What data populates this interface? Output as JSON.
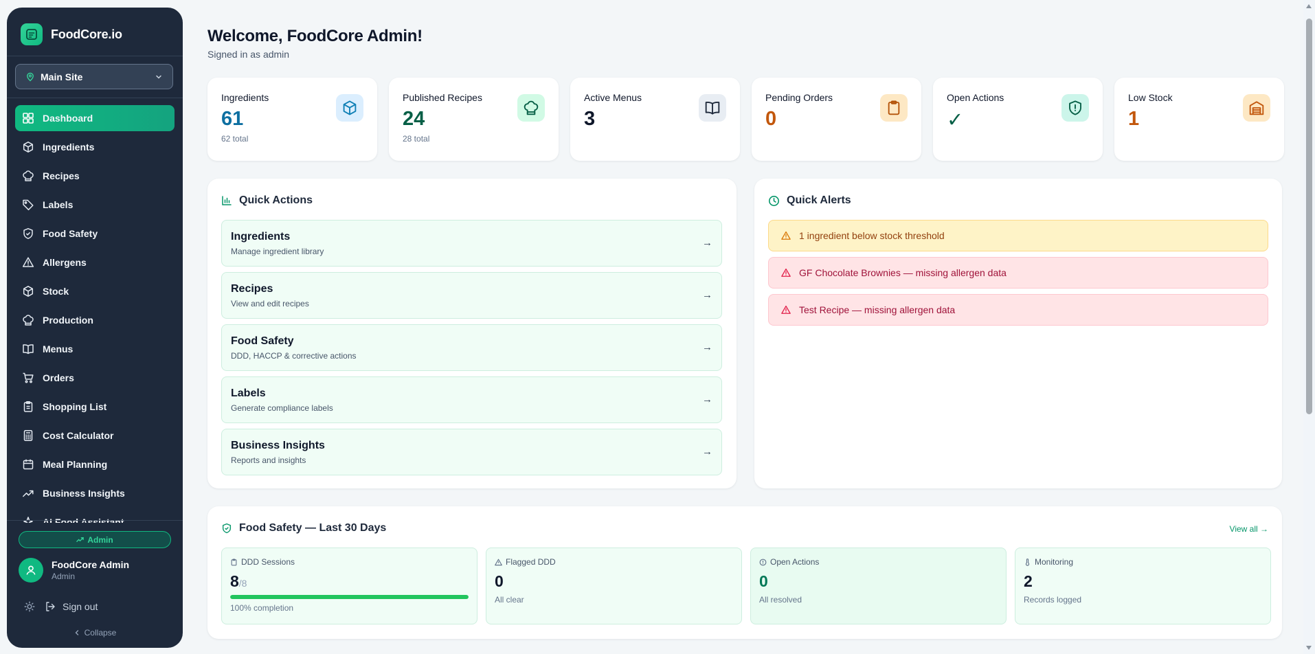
{
  "brand": {
    "name": "FoodCore.io"
  },
  "site_selector": {
    "value": "Main Site"
  },
  "nav": [
    {
      "label": "Dashboard",
      "icon": "dashboard-icon",
      "active": true
    },
    {
      "label": "Ingredients",
      "icon": "box-icon"
    },
    {
      "label": "Recipes",
      "icon": "chef-hat-icon"
    },
    {
      "label": "Labels",
      "icon": "tag-icon"
    },
    {
      "label": "Food Safety",
      "icon": "shield-icon"
    },
    {
      "label": "Allergens",
      "icon": "warning-icon"
    },
    {
      "label": "Stock",
      "icon": "box-icon"
    },
    {
      "label": "Production",
      "icon": "chef-hat-icon"
    },
    {
      "label": "Menus",
      "icon": "book-icon"
    },
    {
      "label": "Orders",
      "icon": "cart-icon"
    },
    {
      "label": "Shopping List",
      "icon": "clipboard-icon"
    },
    {
      "label": "Cost Calculator",
      "icon": "calculator-icon"
    },
    {
      "label": "Meal Planning",
      "icon": "calendar-icon"
    },
    {
      "label": "Business Insights",
      "icon": "trend-icon"
    },
    {
      "label": "AI Food Assistant",
      "icon": "sparkle-icon"
    }
  ],
  "role_badge": "Admin",
  "user": {
    "name": "FoodCore Admin",
    "role": "Admin"
  },
  "sign_out": "Sign out",
  "collapse": "Collapse",
  "header": {
    "title": "Welcome, FoodCore Admin!",
    "subtitle": "Signed in as admin"
  },
  "stats": [
    {
      "label": "Ingredients",
      "value": "61",
      "sub": "62 total",
      "color": "#0e6fa1",
      "icon": "box-icon",
      "icon_bg": "#dbeefe",
      "icon_color": "#0e7fb5"
    },
    {
      "label": "Published Recipes",
      "value": "24",
      "sub": "28 total",
      "color": "#065f46",
      "icon": "chef-hat-icon",
      "icon_bg": "#d1fae5",
      "icon_color": "#065f46"
    },
    {
      "label": "Active Menus",
      "value": "3",
      "sub": "",
      "color": "#0f172a",
      "icon": "book-icon",
      "icon_bg": "#e8edf3",
      "icon_color": "#1e293b"
    },
    {
      "label": "Pending Orders",
      "value": "0",
      "sub": "",
      "color": "#c2570c",
      "icon": "clipboard-icon",
      "icon_bg": "#fde8c4",
      "icon_color": "#b45309"
    },
    {
      "label": "Open Actions",
      "value": "✓",
      "sub": "",
      "color": "#065f46",
      "icon": "shield-alert-icon",
      "icon_bg": "#ccf5ea",
      "icon_color": "#065f46"
    },
    {
      "label": "Low Stock",
      "value": "1",
      "sub": "",
      "color": "#c2570c",
      "icon": "warehouse-icon",
      "icon_bg": "#fde8c4",
      "icon_color": "#c2570c"
    }
  ],
  "quick_actions": {
    "title": "Quick Actions",
    "items": [
      {
        "title": "Ingredients",
        "desc": "Manage ingredient library",
        "arrow": "→"
      },
      {
        "title": "Recipes",
        "desc": "View and edit recipes",
        "arrow": "→"
      },
      {
        "title": "Food Safety",
        "desc": "DDD, HACCP & corrective actions",
        "arrow": "→"
      },
      {
        "title": "Labels",
        "desc": "Generate compliance labels",
        "arrow": "→"
      },
      {
        "title": "Business Insights",
        "desc": "Reports and insights",
        "arrow": "→"
      }
    ]
  },
  "quick_alerts": {
    "title": "Quick Alerts",
    "items": [
      {
        "text": "1 ingredient below stock threshold",
        "level": "warn"
      },
      {
        "text": "GF Chocolate Brownies — missing allergen data",
        "level": "danger"
      },
      {
        "text": "Test Recipe — missing allergen data",
        "level": "danger"
      }
    ]
  },
  "food_safety": {
    "title": "Food Safety — Last 30 Days",
    "view_all": "View all →",
    "cards": [
      {
        "label": "DDD Sessions",
        "value": "8",
        "denom": "/8",
        "sub": "100% completion",
        "progress": 1.0,
        "icon": "clipboard-icon"
      },
      {
        "label": "Flagged DDD",
        "value": "0",
        "sub": "All clear",
        "icon": "warning-icon"
      },
      {
        "label": "Open Actions",
        "value": "0",
        "sub": "All resolved",
        "icon": "alert-circle-icon",
        "green": true
      },
      {
        "label": "Monitoring",
        "value": "2",
        "sub": "Records logged",
        "icon": "thermometer-icon"
      }
    ]
  }
}
